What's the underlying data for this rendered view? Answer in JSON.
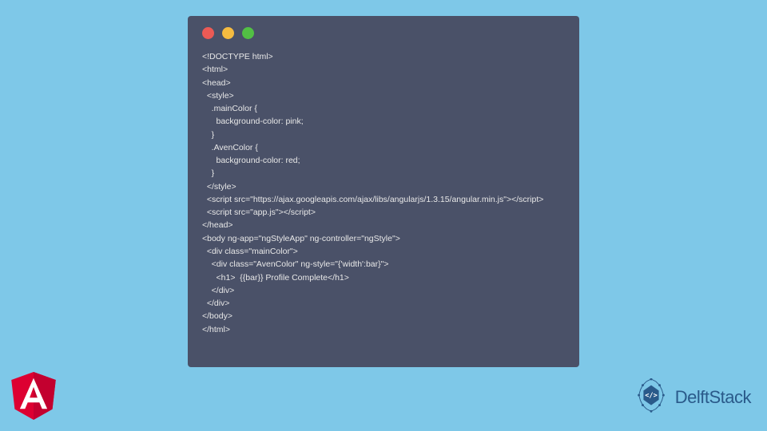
{
  "window": {
    "dot_red": "close",
    "dot_yellow": "minimize",
    "dot_green": "maximize"
  },
  "code_lines": [
    "<!DOCTYPE html>",
    "<html>",
    "<head>",
    "  <style>",
    "    .mainColor {",
    "      background-color: pink;",
    "    }",
    "    .AvenColor {",
    "      background-color: red;",
    "    }",
    "  </style>",
    "  <script src=\"https://ajax.googleapis.com/ajax/libs/angularjs/1.3.15/angular.min.js\"></script>",
    "  <script src=\"app.js\"></script>",
    "</head>",
    "<body ng-app=\"ngStyleApp\" ng-controller=\"ngStyle\">",
    "  <div class=\"mainColor\">",
    "    <div class=\"AvenColor\" ng-style=\"{'width':bar}\">",
    "      <h1>  {{bar}} Profile Complete</h1>",
    "    </div>",
    "  </div>",
    "</body>",
    "</html>"
  ],
  "brand": {
    "delft_text": "DelftStack",
    "angular_name": "Angular",
    "delft_symbol": "</>"
  },
  "colors": {
    "bg": "#7ec8e8",
    "editor": "#4a5168",
    "code_text": "#e8e8e8",
    "angular_red": "#dd0031",
    "delft_blue": "#2a5a8a"
  }
}
